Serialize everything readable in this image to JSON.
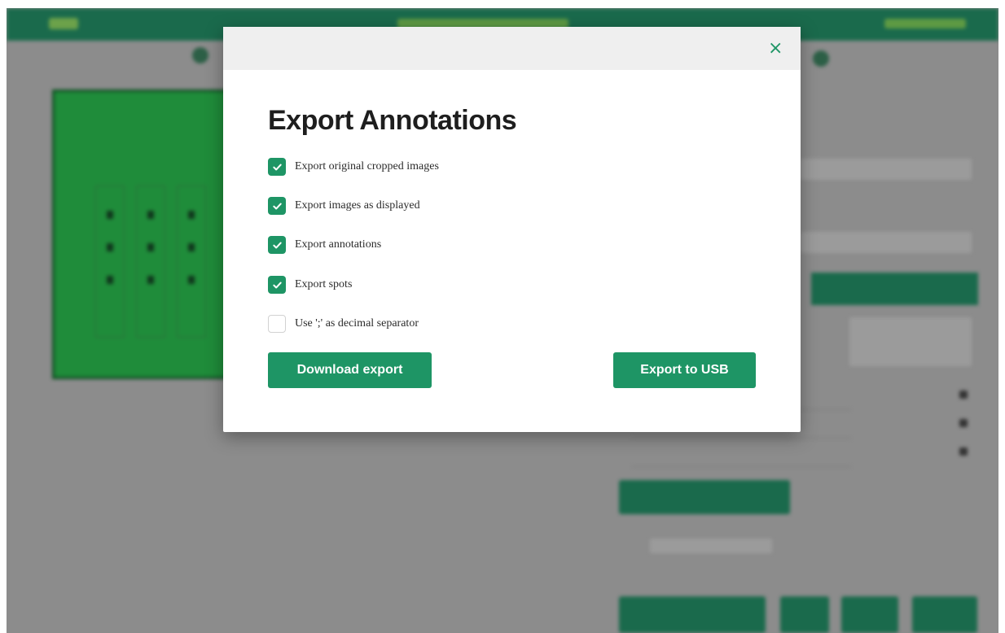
{
  "modal": {
    "title": "Export Annotations",
    "close_icon": "×",
    "options": [
      {
        "label": "Export original cropped images",
        "checked": true
      },
      {
        "label": "Export images as displayed",
        "checked": true
      },
      {
        "label": "Export annotations",
        "checked": true
      },
      {
        "label": "Export spots",
        "checked": true
      },
      {
        "label": "Use ';' as decimal separator",
        "checked": false
      }
    ],
    "download_label": "Download export",
    "usb_label": "Export to USB"
  },
  "colors": {
    "accent": "#1e9565",
    "header": "#1a6a4c"
  },
  "icons": {
    "checkbox_check": "check-icon",
    "close": "close-icon"
  }
}
